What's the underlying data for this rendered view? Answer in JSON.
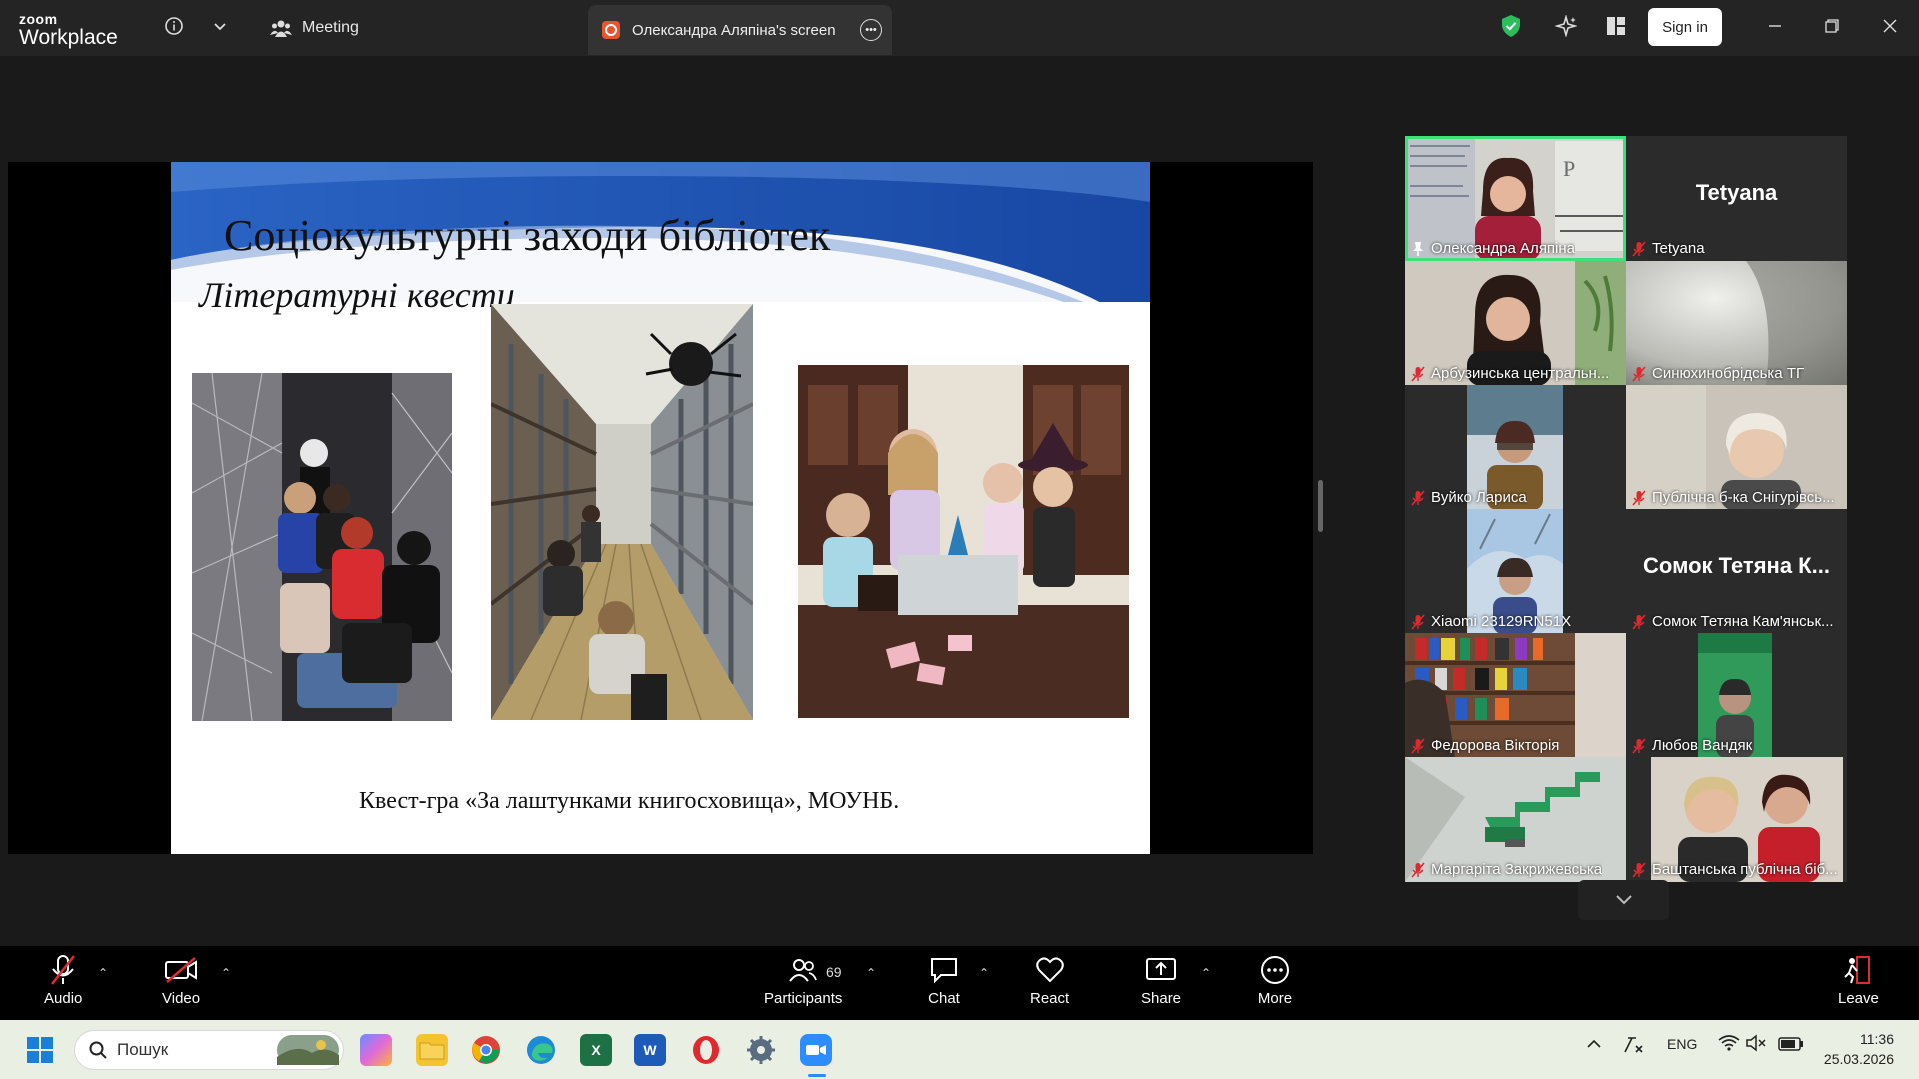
{
  "titlebar": {
    "logo_top": "zoom",
    "logo_bottom": "Workplace",
    "meeting_label": "Meeting",
    "screen_tab_label": "Олександра Аляпіна's screen",
    "signin_label": "Sign in",
    "accent_green": "#3ee07a"
  },
  "slide": {
    "title": "Соціокультурні заходи бібліотек",
    "subtitle": "Літературні квести",
    "caption": "Квест-гра «За лаштунками книгосховища», МОУНБ."
  },
  "gallery": {
    "tiles": [
      {
        "name": "Олександра Аляпіна",
        "big": ""
      },
      {
        "name": "Tetyana",
        "big": "Tetyana"
      },
      {
        "name": "Арбузинська центральн...",
        "big": ""
      },
      {
        "name": "Синюхинобрідська ТГ",
        "big": ""
      },
      {
        "name": "Вуйко Лариса",
        "big": ""
      },
      {
        "name": "Публічна б-ка Снігурівсь...",
        "big": ""
      },
      {
        "name": "Xiaomi 23129RN51X",
        "big": ""
      },
      {
        "name": "Сомок Тетяна Кам'янськ...",
        "big": "Сомок Тетяна К..."
      },
      {
        "name": "Федорова Вікторія",
        "big": ""
      },
      {
        "name": "Любов Вандяк",
        "big": ""
      },
      {
        "name": "Маргаріта Закрижевська",
        "big": ""
      },
      {
        "name": "Баштанська публічна біб...",
        "big": ""
      }
    ]
  },
  "toolbar": {
    "audio": "Audio",
    "video": "Video",
    "participants": "Participants",
    "participants_count": "69",
    "chat": "Chat",
    "react": "React",
    "share": "Share",
    "more": "More",
    "leave": "Leave"
  },
  "taskbar": {
    "search_placeholder": "Пошук",
    "lang": "ENG",
    "time": "11:36",
    "date": "25.03.2026"
  }
}
